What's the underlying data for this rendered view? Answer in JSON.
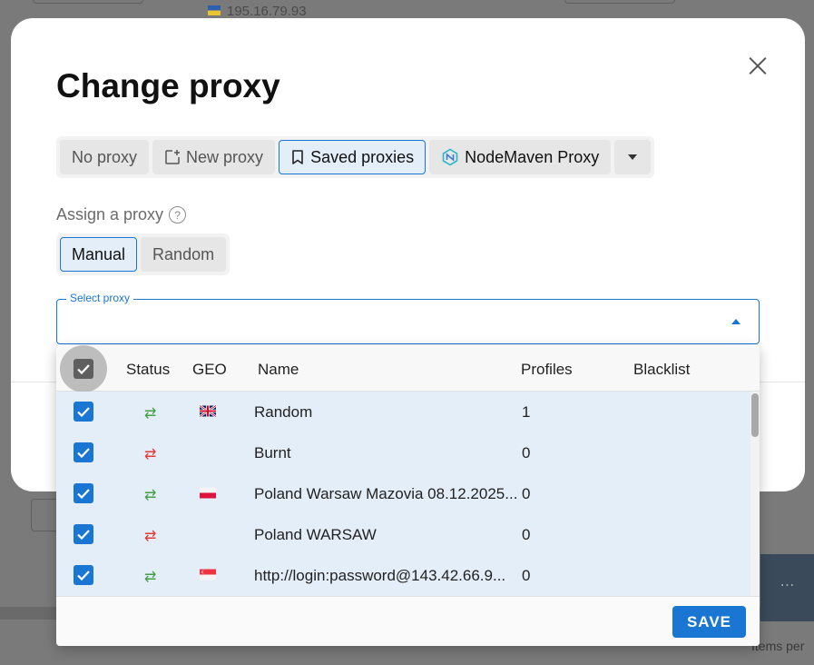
{
  "background": {
    "ip_text": "195.16.79.93",
    "items_per_page_text": "Items per"
  },
  "modal": {
    "title": "Change proxy",
    "tabs": [
      {
        "label": "No proxy"
      },
      {
        "label": "New proxy",
        "icon": "add-square-icon"
      },
      {
        "label": "Saved proxies",
        "icon": "bookmark-icon",
        "active": true
      },
      {
        "label": "NodeMaven Proxy",
        "icon": "nodemaven-logo-icon"
      }
    ],
    "assign_label": "Assign a proxy",
    "assign_modes": [
      {
        "label": "Manual",
        "active": true
      },
      {
        "label": "Random"
      }
    ],
    "select": {
      "label": "Select proxy",
      "value": ""
    }
  },
  "dropdown": {
    "columns": {
      "status": "Status",
      "geo": "GEO",
      "name": "Name",
      "profiles": "Profiles",
      "blacklist": "Blacklist"
    },
    "rows": [
      {
        "checked": true,
        "status": "ok",
        "geo": "gb",
        "name": "Random",
        "profiles": "1",
        "blacklist": ""
      },
      {
        "checked": true,
        "status": "bad",
        "geo": "",
        "name": "Burnt",
        "profiles": "0",
        "blacklist": ""
      },
      {
        "checked": true,
        "status": "ok",
        "geo": "pl",
        "name": "Poland Warsaw Mazovia 08.12.2025...",
        "profiles": "0",
        "blacklist": ""
      },
      {
        "checked": true,
        "status": "bad",
        "geo": "",
        "name": "Poland WARSAW",
        "profiles": "0",
        "blacklist": ""
      },
      {
        "checked": true,
        "status": "ok",
        "geo": "sg",
        "name": "http://login:password@143.42.66.9...",
        "profiles": "0",
        "blacklist": ""
      }
    ],
    "save_label": "SAVE"
  },
  "colors": {
    "accent": "#1976d2",
    "selected_row": "#e4eef8",
    "status_ok": "#43a047",
    "status_bad": "#e53935"
  }
}
